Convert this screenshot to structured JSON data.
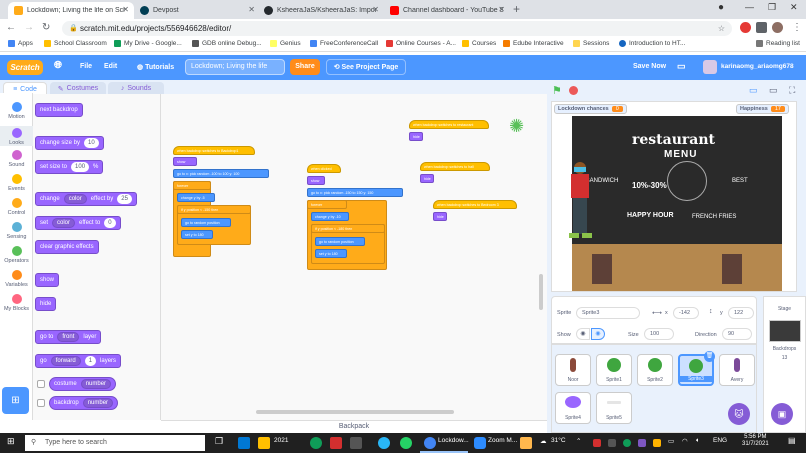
{
  "browser": {
    "tabs": [
      {
        "label": "Lockdown; Living the life on Scr",
        "fav": "scratch-icon",
        "color": "#ffab19",
        "active": true
      },
      {
        "label": "Devpost",
        "fav": "devpost-icon",
        "color": "#003e54",
        "active": false
      },
      {
        "label": "KsheeraJaS/KsheeraJaS: Import a",
        "fav": "github-icon",
        "color": "#24292e",
        "active": false
      },
      {
        "label": "Channel dashboard - YouTube St",
        "fav": "youtube-icon",
        "color": "#ff0000",
        "active": false
      }
    ],
    "url": "scratch.mit.edu/projects/556946628/editor/",
    "bookmarks": [
      "Apps",
      "School Classroom",
      "My Drive - Google...",
      "GDB online Debug...",
      "Genius",
      "FreeConferenceCall",
      "Online Courses - A...",
      "Courses",
      "Edube Interactive",
      "Sessions",
      "Introduction to HT..."
    ],
    "reading_list": "Reading list"
  },
  "menubar": {
    "logo": "Scratch",
    "file": "File",
    "edit": "Edit",
    "tutorials": "Tutorials",
    "project_title": "Lockdown; Living the life",
    "share": "Share",
    "see_project": "See Project Page",
    "save_now": "Save Now",
    "username": "karinaomg_ariaomg678"
  },
  "editor_tabs": {
    "code": "Code",
    "costumes": "Costumes",
    "sounds": "Sounds"
  },
  "categories": [
    {
      "label": "Motion",
      "color": "#4c97ff"
    },
    {
      "label": "Looks",
      "color": "#9966ff"
    },
    {
      "label": "Sound",
      "color": "#cf63cf"
    },
    {
      "label": "Events",
      "color": "#ffbf00"
    },
    {
      "label": "Control",
      "color": "#ffab19"
    },
    {
      "label": "Sensing",
      "color": "#5cb1d6"
    },
    {
      "label": "Operators",
      "color": "#59c059"
    },
    {
      "label": "Variables",
      "color": "#ff8c1a"
    },
    {
      "label": "My Blocks",
      "color": "#ff6680"
    }
  ],
  "palette": {
    "next_backdrop": "next backdrop",
    "change_size": "change size by",
    "change_size_val": "10",
    "set_size": "set size to",
    "set_size_val": "100",
    "set_size_unit": "%",
    "change_effect": "change",
    "effect_color": "color",
    "effect_by": "effect by",
    "effect_by_val": "25",
    "set_effect": "set",
    "effect_to": "effect to",
    "effect_to_val": "0",
    "clear_effects": "clear graphic effects",
    "show": "show",
    "hide": "hide",
    "go_to": "go to",
    "front": "front",
    "layer": "layer",
    "go": "go",
    "forward": "forward",
    "layers_val": "1",
    "layers": "layers",
    "costume": "costume",
    "backdrop": "backdrop",
    "number": "number"
  },
  "scripts": {
    "s1_hat": "when backdrop switches to  Backdrop1",
    "show": "show",
    "goto_rand": "go to x:  pick random  -100 to 100  y: 100",
    "forever": "forever",
    "change_y": "change y by  -5",
    "if_y": "if  y position  <  -150  then",
    "goto_random_pos": "go to  random position",
    "set_y": "set y to  180",
    "s2_hat": "when clicked",
    "s2_goto": "go to x:  pick random  -150 to 150  y: 150",
    "s2_change_y": "change y by  -10",
    "s2_if": "if  y position  <  -180  then",
    "s2_goto_rand": "go to  random position",
    "s2_set_y": "set y to  180",
    "s3_hat": "when backdrop switches to  restaurant",
    "hide": "hide",
    "s4_hat": "when backdrop switches to  hall",
    "s5_hat": "when backdrop switches to  Bedroom 3"
  },
  "backpack": "Backpack",
  "stage": {
    "monitor1_label": "Lockdown chances",
    "monitor1_val": "0",
    "monitor2_label": "Happiness",
    "monitor2_val": "17",
    "board_title": "restaurant",
    "board_menu": "MENU",
    "board_happy": "HAPPY HOUR",
    "board_discount": "10%-30%",
    "board_fresh": "FRENCH FRIES",
    "board_sandwich": "SANDWICH",
    "board_best": "BEST"
  },
  "sprite_info": {
    "sprite_label": "Sprite",
    "sprite_name": "Sprite3",
    "x_label": "x",
    "x_val": "-142",
    "y_label": "y",
    "y_val": "122",
    "show_label": "Show",
    "size_label": "Size",
    "size_val": "100",
    "direction_label": "Direction",
    "direction_val": "90"
  },
  "sprites": [
    {
      "name": "Noor",
      "color": "#8b4a3a"
    },
    {
      "name": "Sprite1",
      "color": "#3fa63f"
    },
    {
      "name": "Sprite2",
      "color": "#3fa63f"
    },
    {
      "name": "Sprite3",
      "color": "#3fa63f",
      "selected": true
    },
    {
      "name": "Avery",
      "color": "#7b4a99"
    },
    {
      "name": "Sprite4",
      "color": "#9966ff"
    },
    {
      "name": "Sprite5",
      "color": "#e5e5e5"
    }
  ],
  "stage_pane": {
    "label": "Stage",
    "backdrops_label": "Backdrops",
    "backdrops_count": "13"
  },
  "taskbar": {
    "search": "Type here to search",
    "folder": "2021",
    "chrome": "Lockdow...",
    "zoom": "Zoom M...",
    "weather": "31°C",
    "lang": "ENG",
    "time": "5:56 PM",
    "date": "31/7/2021"
  }
}
